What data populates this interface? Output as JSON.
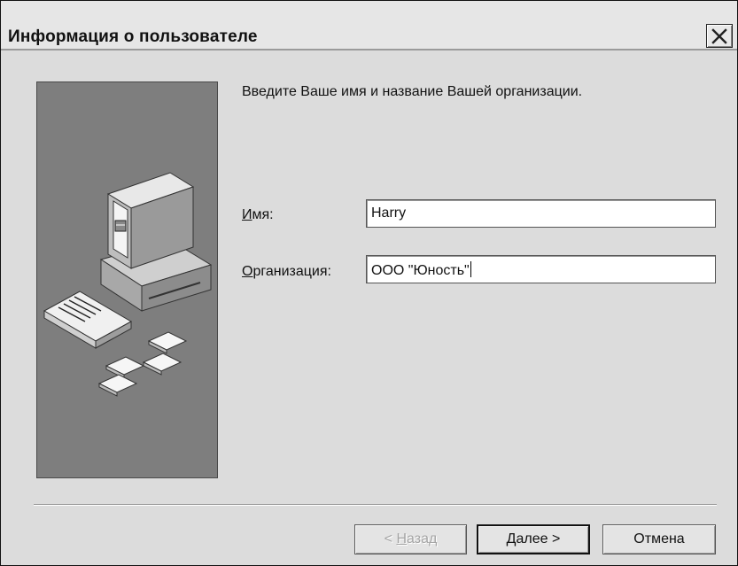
{
  "dialog": {
    "title": "Информация о пользователе",
    "intro": "Введите Ваше имя и название Вашей организации."
  },
  "fields": {
    "name": {
      "label_hotkey": "И",
      "label_rest": "мя:",
      "value": "Harry"
    },
    "organization": {
      "label_hotkey": "О",
      "label_rest": "рганизация:",
      "value": "ООО \"Юность\""
    }
  },
  "buttons": {
    "back": {
      "prefix": "< ",
      "hotkey": "Н",
      "rest": "азад",
      "enabled": false
    },
    "next": {
      "hotkey": "Д",
      "rest": "алее",
      "suffix": " >",
      "default": true
    },
    "cancel": {
      "label": "Отмена"
    }
  },
  "icons": {
    "close": "close-icon",
    "illustration": "computer-with-diskettes-illustration"
  }
}
